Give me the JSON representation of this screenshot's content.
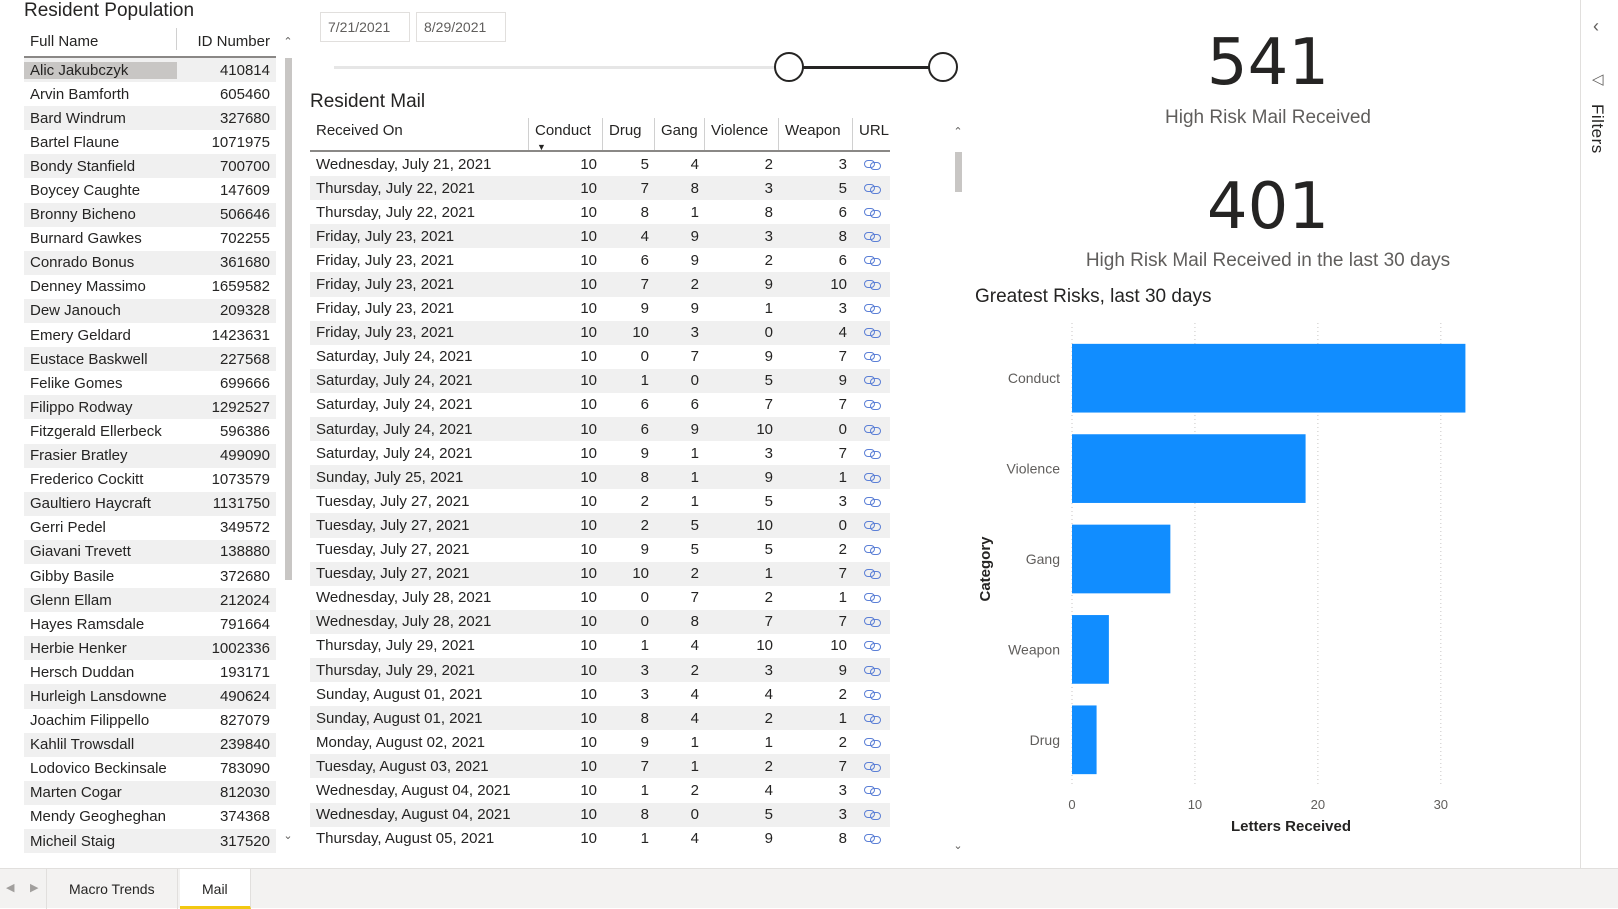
{
  "population": {
    "title": "Resident Population",
    "columns": [
      "Full Name",
      "ID Number"
    ],
    "rows": [
      [
        "Alic Jakubczyk",
        "410814"
      ],
      [
        "Arvin Bamforth",
        "605460"
      ],
      [
        "Bard Windrum",
        "327680"
      ],
      [
        "Bartel Flaune",
        "1071975"
      ],
      [
        "Bondy Stanfield",
        "700700"
      ],
      [
        "Boycey Caughte",
        "147609"
      ],
      [
        "Bronny Bicheno",
        "506646"
      ],
      [
        "Burnard Gawkes",
        "702255"
      ],
      [
        "Conrado Bonus",
        "361680"
      ],
      [
        "Denney Massimo",
        "1659582"
      ],
      [
        "Dew Janouch",
        "209328"
      ],
      [
        "Emery Geldard",
        "1423631"
      ],
      [
        "Eustace Baskwell",
        "227568"
      ],
      [
        "Felike Gomes",
        "699666"
      ],
      [
        "Filippo Rodway",
        "1292527"
      ],
      [
        "Fitzgerald Ellerbeck",
        "596386"
      ],
      [
        "Frasier Bratley",
        "499090"
      ],
      [
        "Frederico Cockitt",
        "1073579"
      ],
      [
        "Gaultiero Haycraft",
        "1131750"
      ],
      [
        "Gerri Pedel",
        "349572"
      ],
      [
        "Giavani Trevett",
        "138880"
      ],
      [
        "Gibby Basile",
        "372680"
      ],
      [
        "Glenn Ellam",
        "212024"
      ],
      [
        "Hayes Ramsdale",
        "791664"
      ],
      [
        "Herbie Henker",
        "1002336"
      ],
      [
        "Hersch Duddan",
        "193171"
      ],
      [
        "Hurleigh Lansdowne",
        "490624"
      ],
      [
        "Joachim Filippello",
        "827079"
      ],
      [
        "Kahlil Trowsdall",
        "239840"
      ],
      [
        "Lodovico Beckinsale",
        "783090"
      ],
      [
        "Marten Cogar",
        "812030"
      ],
      [
        "Mendy Geogheghan",
        "374368"
      ],
      [
        "Micheil Staig",
        "317520"
      ]
    ]
  },
  "slicer": {
    "start": "7/21/2021",
    "end": "8/29/2021"
  },
  "mail": {
    "title": "Resident Mail",
    "columns": [
      "Received On",
      "Conduct",
      "Drug",
      "Gang",
      "Violence",
      "Weapon",
      "URL"
    ],
    "rows": [
      [
        "Wednesday, July 21, 2021",
        "10",
        "5",
        "4",
        "2",
        "3"
      ],
      [
        "Thursday, July 22, 2021",
        "10",
        "7",
        "8",
        "3",
        "5"
      ],
      [
        "Thursday, July 22, 2021",
        "10",
        "8",
        "1",
        "8",
        "6"
      ],
      [
        "Friday, July 23, 2021",
        "10",
        "4",
        "9",
        "3",
        "8"
      ],
      [
        "Friday, July 23, 2021",
        "10",
        "6",
        "9",
        "2",
        "6"
      ],
      [
        "Friday, July 23, 2021",
        "10",
        "7",
        "2",
        "9",
        "10"
      ],
      [
        "Friday, July 23, 2021",
        "10",
        "9",
        "9",
        "1",
        "3"
      ],
      [
        "Friday, July 23, 2021",
        "10",
        "10",
        "3",
        "0",
        "4"
      ],
      [
        "Saturday, July 24, 2021",
        "10",
        "0",
        "7",
        "9",
        "7"
      ],
      [
        "Saturday, July 24, 2021",
        "10",
        "1",
        "0",
        "5",
        "9"
      ],
      [
        "Saturday, July 24, 2021",
        "10",
        "6",
        "6",
        "7",
        "7"
      ],
      [
        "Saturday, July 24, 2021",
        "10",
        "6",
        "9",
        "10",
        "0"
      ],
      [
        "Saturday, July 24, 2021",
        "10",
        "9",
        "1",
        "3",
        "7"
      ],
      [
        "Sunday, July 25, 2021",
        "10",
        "8",
        "1",
        "9",
        "1"
      ],
      [
        "Tuesday, July 27, 2021",
        "10",
        "2",
        "1",
        "5",
        "3"
      ],
      [
        "Tuesday, July 27, 2021",
        "10",
        "2",
        "5",
        "10",
        "0"
      ],
      [
        "Tuesday, July 27, 2021",
        "10",
        "9",
        "5",
        "5",
        "2"
      ],
      [
        "Tuesday, July 27, 2021",
        "10",
        "10",
        "2",
        "1",
        "7"
      ],
      [
        "Wednesday, July 28, 2021",
        "10",
        "0",
        "7",
        "2",
        "1"
      ],
      [
        "Wednesday, July 28, 2021",
        "10",
        "0",
        "8",
        "7",
        "7"
      ],
      [
        "Thursday, July 29, 2021",
        "10",
        "1",
        "4",
        "10",
        "10"
      ],
      [
        "Thursday, July 29, 2021",
        "10",
        "3",
        "2",
        "3",
        "9"
      ],
      [
        "Sunday, August 01, 2021",
        "10",
        "3",
        "4",
        "4",
        "2"
      ],
      [
        "Sunday, August 01, 2021",
        "10",
        "8",
        "4",
        "2",
        "1"
      ],
      [
        "Monday, August 02, 2021",
        "10",
        "9",
        "1",
        "1",
        "2"
      ],
      [
        "Tuesday, August 03, 2021",
        "10",
        "7",
        "1",
        "2",
        "7"
      ],
      [
        "Wednesday, August 04, 2021",
        "10",
        "1",
        "2",
        "4",
        "3"
      ],
      [
        "Wednesday, August 04, 2021",
        "10",
        "8",
        "0",
        "5",
        "3"
      ],
      [
        "Thursday, August 05, 2021",
        "10",
        "1",
        "4",
        "9",
        "8"
      ]
    ]
  },
  "kpi1": {
    "value": "541",
    "label": "High Risk Mail Received"
  },
  "kpi2": {
    "value": "401",
    "label": "High Risk Mail Received in the last 30 days"
  },
  "chart_data": {
    "type": "bar",
    "orientation": "horizontal",
    "title": "Greatest Risks, last 30 days",
    "xlabel": "Letters Received",
    "ylabel": "Category",
    "categories": [
      "Conduct",
      "Violence",
      "Gang",
      "Weapon",
      "Drug"
    ],
    "values": [
      32,
      19,
      8,
      3,
      2
    ],
    "xlim": [
      0,
      34
    ],
    "xticks": [
      0,
      10,
      20,
      30
    ],
    "grid": true,
    "color": "#118dff"
  },
  "filters": {
    "label": "Filters"
  },
  "tabs": [
    {
      "label": "Macro Trends",
      "active": false
    },
    {
      "label": "Mail",
      "active": true
    }
  ]
}
